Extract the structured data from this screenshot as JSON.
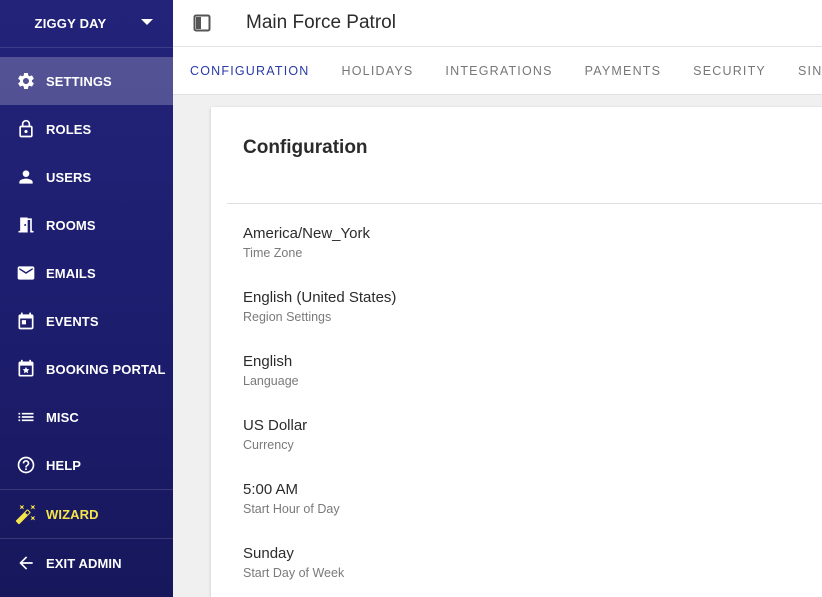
{
  "sidebar": {
    "org_name": "ZIGGY DAY",
    "items": [
      {
        "label": "SETTINGS",
        "icon": "gear-icon",
        "active": true
      },
      {
        "label": "ROLES",
        "icon": "lock-icon"
      },
      {
        "label": "USERS",
        "icon": "person-icon"
      },
      {
        "label": "ROOMS",
        "icon": "door-icon"
      },
      {
        "label": "EMAILS",
        "icon": "envelope-icon"
      },
      {
        "label": "EVENTS",
        "icon": "calendar-icon"
      },
      {
        "label": "BOOKING PORTAL",
        "icon": "calendar-star-icon"
      },
      {
        "label": "MISC",
        "icon": "list-icon"
      },
      {
        "label": "HELP",
        "icon": "help-circle-icon"
      },
      {
        "label": "WIZARD",
        "icon": "magic-wand-icon"
      },
      {
        "label": "EXIT ADMIN",
        "icon": "arrow-left-icon"
      }
    ]
  },
  "header": {
    "title": "Main Force Patrol"
  },
  "tabs": [
    {
      "label": "CONFIGURATION",
      "active": true
    },
    {
      "label": "HOLIDAYS"
    },
    {
      "label": "INTEGRATIONS"
    },
    {
      "label": "PAYMENTS"
    },
    {
      "label": "SECURITY"
    },
    {
      "label": "SINGLE"
    }
  ],
  "config": {
    "title": "Configuration",
    "fields": [
      {
        "value": "America/New_York",
        "caption": "Time Zone"
      },
      {
        "value": "English (United States)",
        "caption": "Region Settings"
      },
      {
        "value": "English",
        "caption": "Language"
      },
      {
        "value": "US Dollar",
        "caption": "Currency"
      },
      {
        "value": "5:00 AM",
        "caption": "Start Hour of Day"
      },
      {
        "value": "Sunday",
        "caption": "Start Day of Week"
      }
    ]
  },
  "colors": {
    "sidebar": "#1f1f72",
    "accent": "#3a4ad0",
    "wizard": "#f5e54a"
  }
}
